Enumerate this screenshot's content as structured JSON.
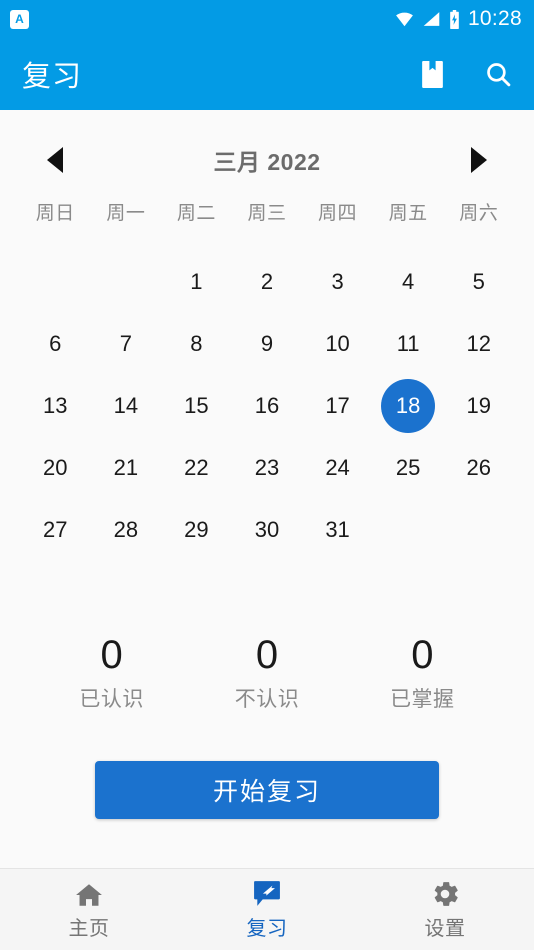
{
  "status_bar": {
    "notification_icon": "app-notification-icon",
    "notification_letter": "A",
    "wifi_icon": "wifi-icon",
    "signal_icon": "signal-icon",
    "battery_icon": "battery-charging-icon",
    "time": "10:28"
  },
  "app_bar": {
    "title": "复习",
    "bookmark_icon": "bookmark-icon",
    "search_icon": "search-icon",
    "background_color": "#039BE5"
  },
  "calendar": {
    "prev_icon": "chevron-left-icon",
    "next_icon": "chevron-right-icon",
    "month_title": "三月 2022",
    "weekdays": [
      "周日",
      "周一",
      "周二",
      "周三",
      "周四",
      "周五",
      "周六"
    ],
    "leading_blanks": 2,
    "days": [
      1,
      2,
      3,
      4,
      5,
      6,
      7,
      8,
      9,
      10,
      11,
      12,
      13,
      14,
      15,
      16,
      17,
      18,
      19,
      20,
      21,
      22,
      23,
      24,
      25,
      26,
      27,
      28,
      29,
      30,
      31
    ],
    "selected_day": 18,
    "selected_color": "#1B72CE"
  },
  "stats": [
    {
      "value": "0",
      "label": "已认识"
    },
    {
      "value": "0",
      "label": "不认识"
    },
    {
      "value": "0",
      "label": "已掌握"
    }
  ],
  "primary_button": {
    "label": "开始复习",
    "color": "#1B72CE"
  },
  "bottom_nav": {
    "active_color": "#1565C0",
    "items": [
      {
        "label": "主页",
        "icon": "home-icon",
        "active": false
      },
      {
        "label": "复习",
        "icon": "review-chat-edit-icon",
        "active": true
      },
      {
        "label": "设置",
        "icon": "gear-icon",
        "active": false
      }
    ]
  }
}
